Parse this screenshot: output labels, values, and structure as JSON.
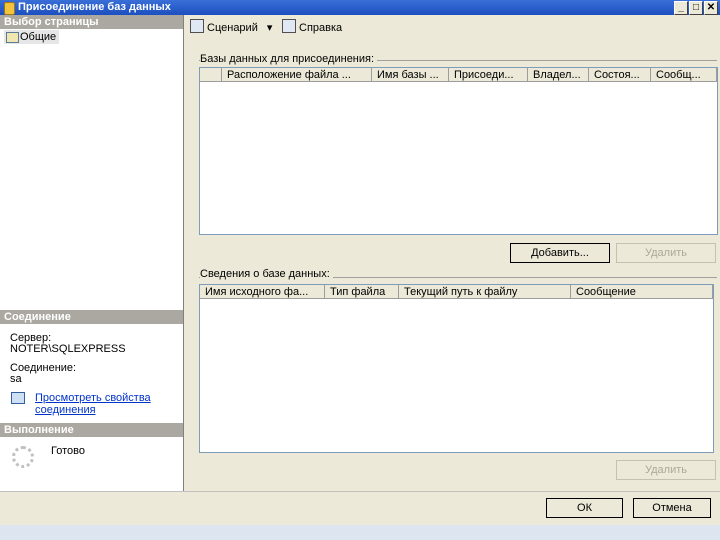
{
  "window": {
    "title": "Присоединение баз данных",
    "minimize": "_",
    "maximize": "□",
    "close": "✕"
  },
  "left": {
    "pages_header": "Выбор страницы",
    "page_item": "Общие",
    "connection_header": "Соединение",
    "server_label": "Сервер:",
    "server_value": "NOTER\\SQLEXPRESS",
    "connection_label": "Соединение:",
    "connection_value": "sa",
    "view_props_line1": "Просмотреть свойства",
    "view_props_line2": "соединения",
    "progress_header": "Выполнение",
    "status": "Готово"
  },
  "toolbar": {
    "script": "Сценарий",
    "script_arrow": "▾",
    "help": "Справка"
  },
  "attach": {
    "label": "Базы данных для присоединения:",
    "columns": [
      "",
      "Расположение файла ...",
      "Имя базы ...",
      "Присоеди...",
      "Владел...",
      "Состоя...",
      "Сообщ..."
    ],
    "add_button": "Добавить...",
    "remove_button": "Удалить"
  },
  "details": {
    "label": "Сведения о базе данных:",
    "columns": [
      "Имя исходного фа...",
      "Тип файла",
      "Текущий путь к файлу",
      "Сообщение"
    ],
    "remove_button": "Удалить"
  },
  "dialog": {
    "ok": "ОК",
    "cancel": "Отмена"
  }
}
